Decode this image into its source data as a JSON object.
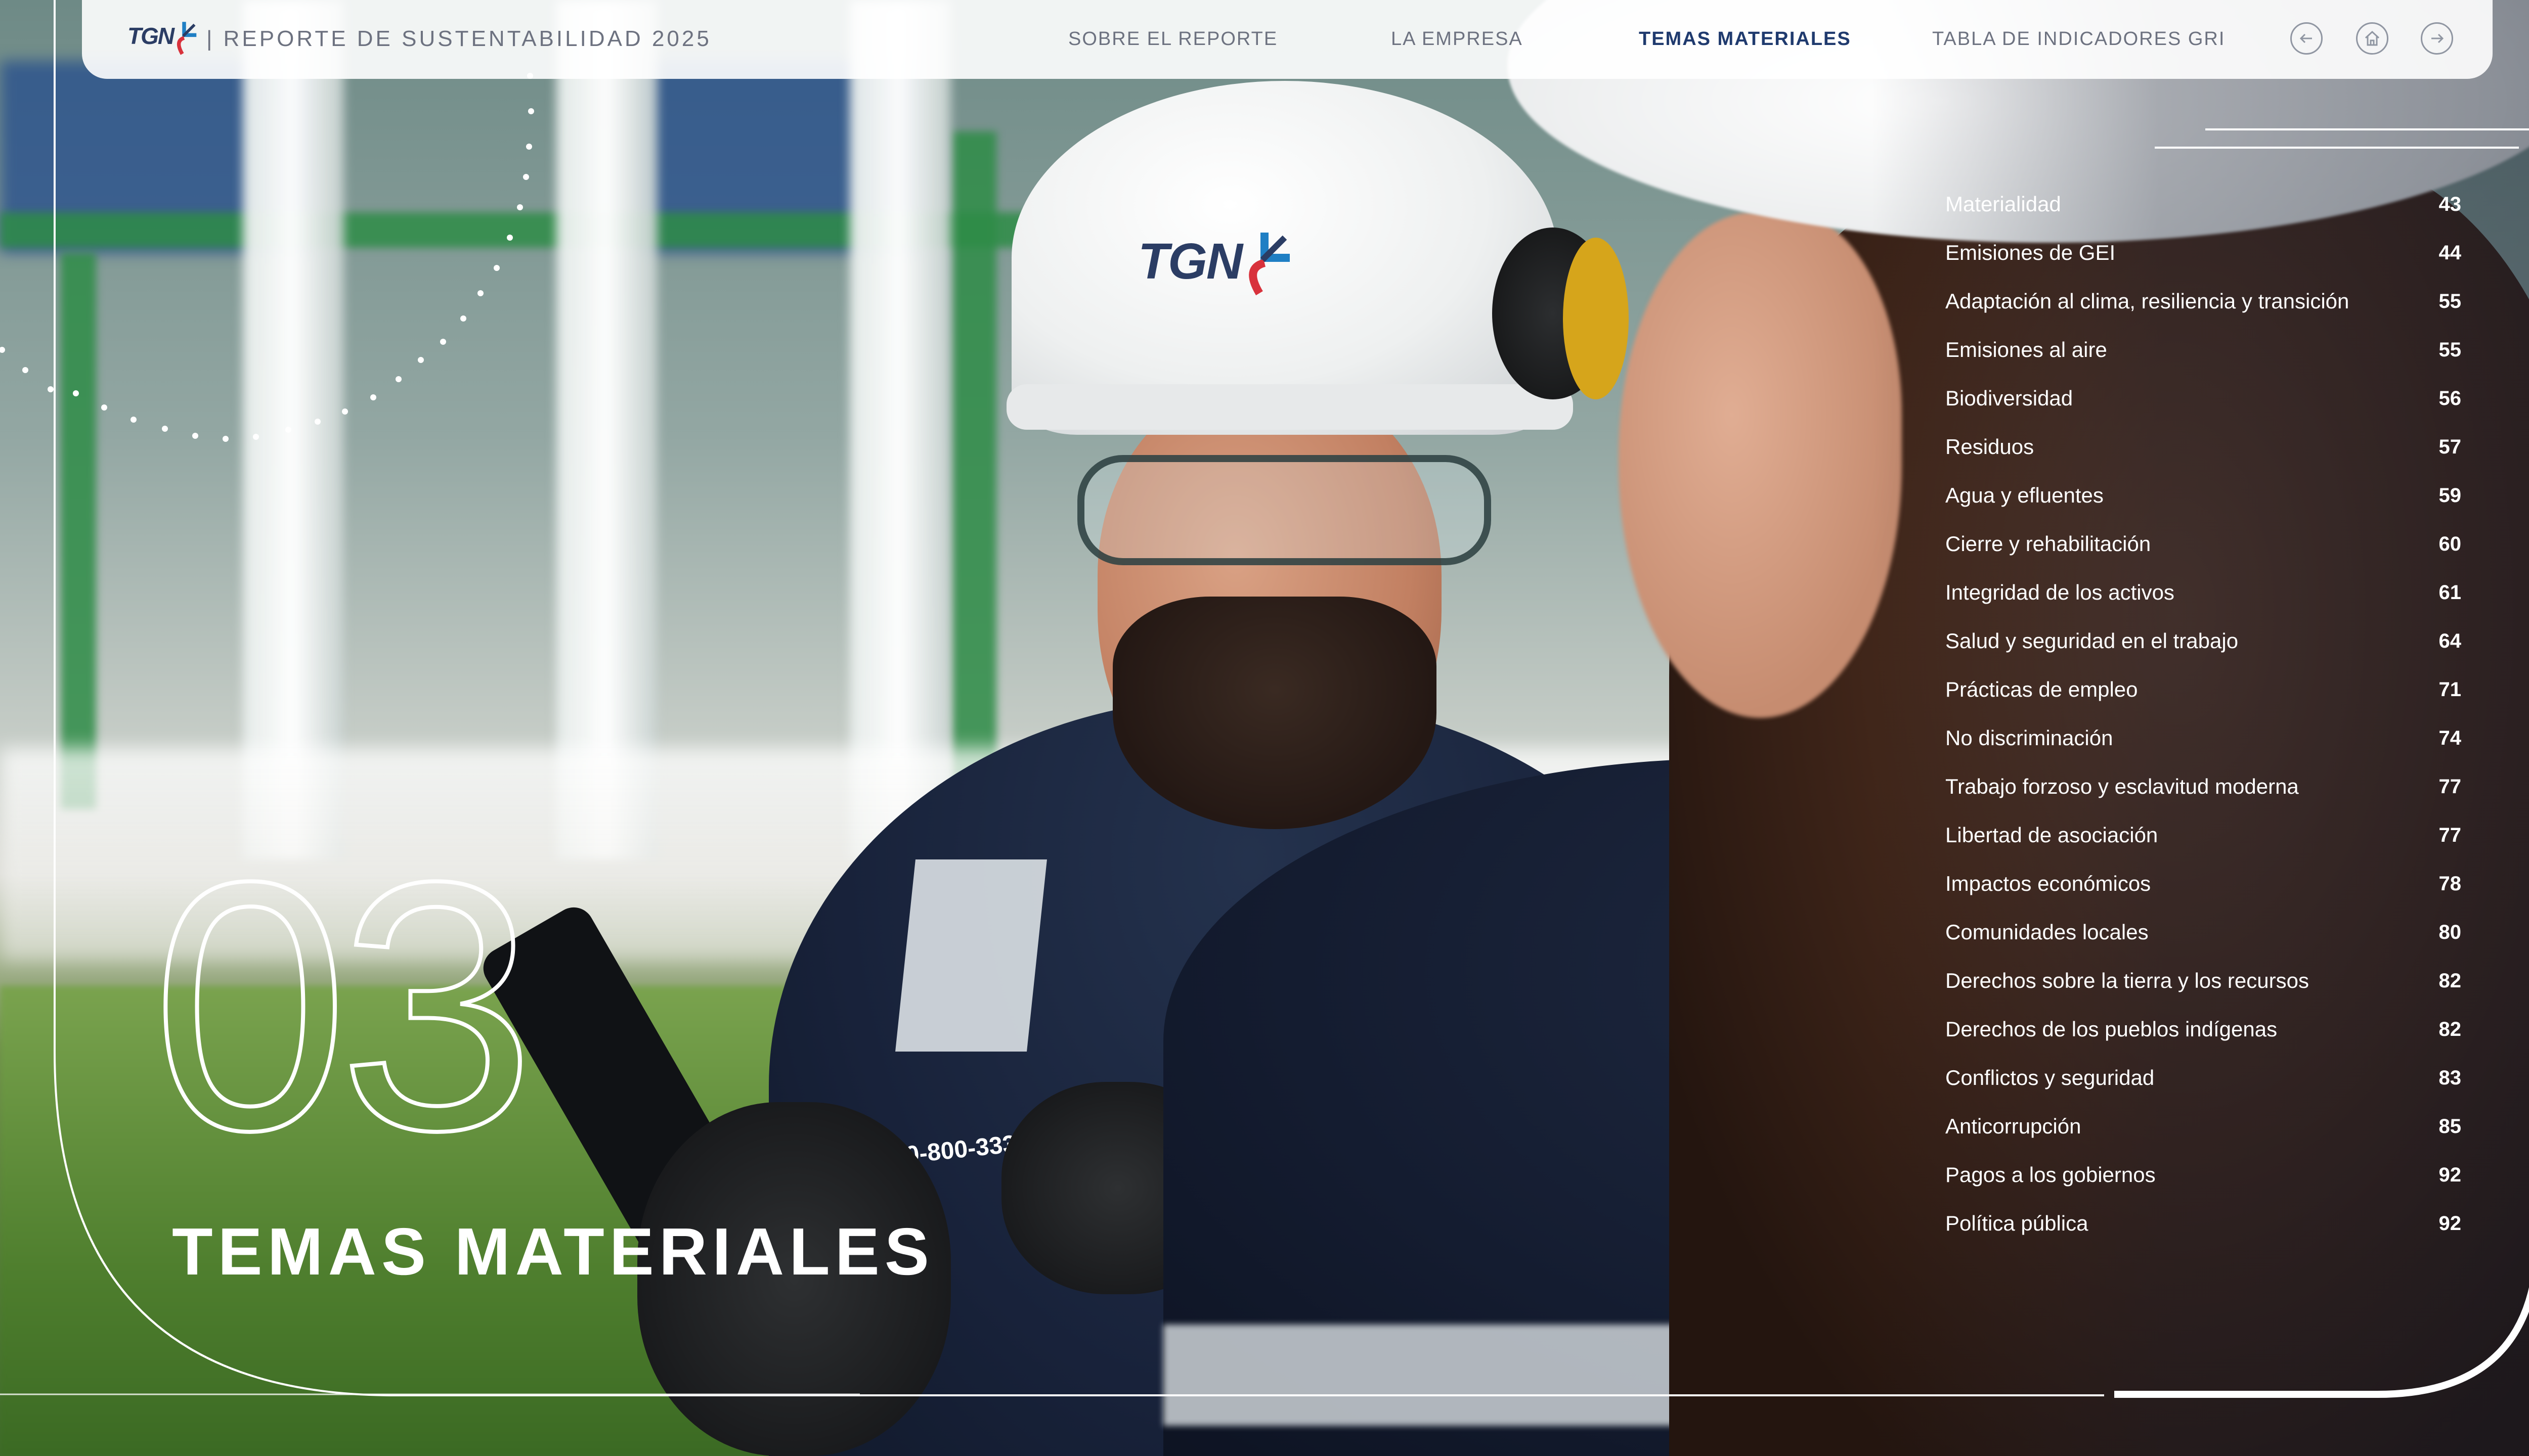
{
  "header": {
    "logo_text": "TGN",
    "report_title": "| REPORTE DE SUSTENTABILIDAD 2025",
    "nav": [
      {
        "label": "SOBRE EL REPORTE",
        "active": false
      },
      {
        "label": "LA EMPRESA",
        "active": false
      },
      {
        "label": "TEMAS MATERIALES",
        "active": true
      },
      {
        "label": "TABLA DE INDICADORES GRI",
        "active": false
      }
    ],
    "icons": [
      "arrow-left-icon",
      "home-icon",
      "arrow-right-icon"
    ]
  },
  "photo": {
    "helmet_logo": "TGN",
    "uniform_phone_text": "0-800-333-2227"
  },
  "chapter": {
    "number": "03",
    "title": "TEMAS MATERIALES"
  },
  "toc": [
    {
      "topic": "Materialidad",
      "page": "43"
    },
    {
      "topic": "Emisiones de GEI",
      "page": "44"
    },
    {
      "topic": "Adaptación al clima, resiliencia y transición",
      "page": "55"
    },
    {
      "topic": "Emisiones al aire",
      "page": "55"
    },
    {
      "topic": "Biodiversidad",
      "page": "56"
    },
    {
      "topic": "Residuos",
      "page": "57"
    },
    {
      "topic": "Agua y efluentes",
      "page": "59"
    },
    {
      "topic": "Cierre y rehabilitación",
      "page": "60"
    },
    {
      "topic": "Integridad de los activos",
      "page": "61"
    },
    {
      "topic": "Salud y seguridad en el trabajo",
      "page": "64"
    },
    {
      "topic": "Prácticas de empleo",
      "page": "71"
    },
    {
      "topic": "No discriminación",
      "page": "74"
    },
    {
      "topic": "Trabajo forzoso y esclavitud moderna",
      "page": "77"
    },
    {
      "topic": "Libertad de asociación",
      "page": "77"
    },
    {
      "topic": "Impactos económicos",
      "page": "78"
    },
    {
      "topic": "Comunidades locales",
      "page": "80"
    },
    {
      "topic": "Derechos sobre la tierra y los recursos",
      "page": "82"
    },
    {
      "topic": "Derechos de los pueblos indígenas",
      "page": "82"
    },
    {
      "topic": "Conflictos y seguridad",
      "page": "83"
    },
    {
      "topic": "Anticorrupción",
      "page": "85"
    },
    {
      "topic": "Pagos a los gobiernos",
      "page": "92"
    },
    {
      "topic": "Política pública",
      "page": "92"
    }
  ],
  "colors": {
    "brand_navy": "#2b3d64",
    "brand_red": "#d8323c",
    "brand_blue": "#1f7fc4",
    "nav_active": "#1f3a6e",
    "nav_inactive": "#6d7280"
  }
}
